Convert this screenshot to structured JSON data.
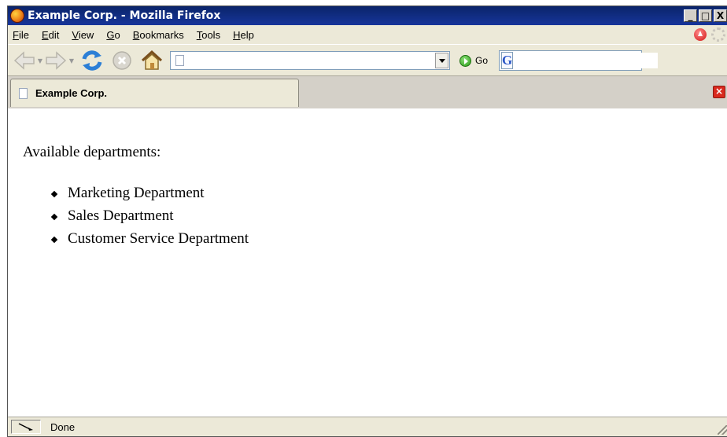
{
  "window": {
    "title": "Example Corp. - Mozilla Firefox",
    "controls": [
      "_",
      "□",
      "X"
    ]
  },
  "menu": {
    "items": [
      {
        "label": "File",
        "accel": "F",
        "rest": "ile"
      },
      {
        "label": "Edit",
        "accel": "E",
        "rest": "dit"
      },
      {
        "label": "View",
        "accel": "V",
        "rest": "iew"
      },
      {
        "label": "Go",
        "accel": "G",
        "rest": "o"
      },
      {
        "label": "Bookmarks",
        "accel": "B",
        "rest": "ookmarks"
      },
      {
        "label": "Tools",
        "accel": "T",
        "rest": "ools"
      },
      {
        "label": "Help",
        "accel": "H",
        "rest": "elp"
      }
    ]
  },
  "toolbar": {
    "icons": [
      "back-arrow-icon",
      "forward-arrow-icon",
      "reload-icon",
      "stop-icon",
      "home-icon"
    ],
    "url_value": "",
    "go_label": "Go",
    "search_value": "",
    "search_engine_letter": "G"
  },
  "tab": {
    "label": "Example Corp.",
    "close_glyph": "×"
  },
  "content": {
    "intro": "Available departments:",
    "departments": [
      "Marketing Department",
      "Sales Department",
      "Customer Service Department"
    ]
  },
  "status": {
    "text": "Done"
  },
  "colors": {
    "titlebar": "#0a246a",
    "chrome": "#ece9d8",
    "tab_close": "#d9291e",
    "go_green": "#2a9d16"
  }
}
